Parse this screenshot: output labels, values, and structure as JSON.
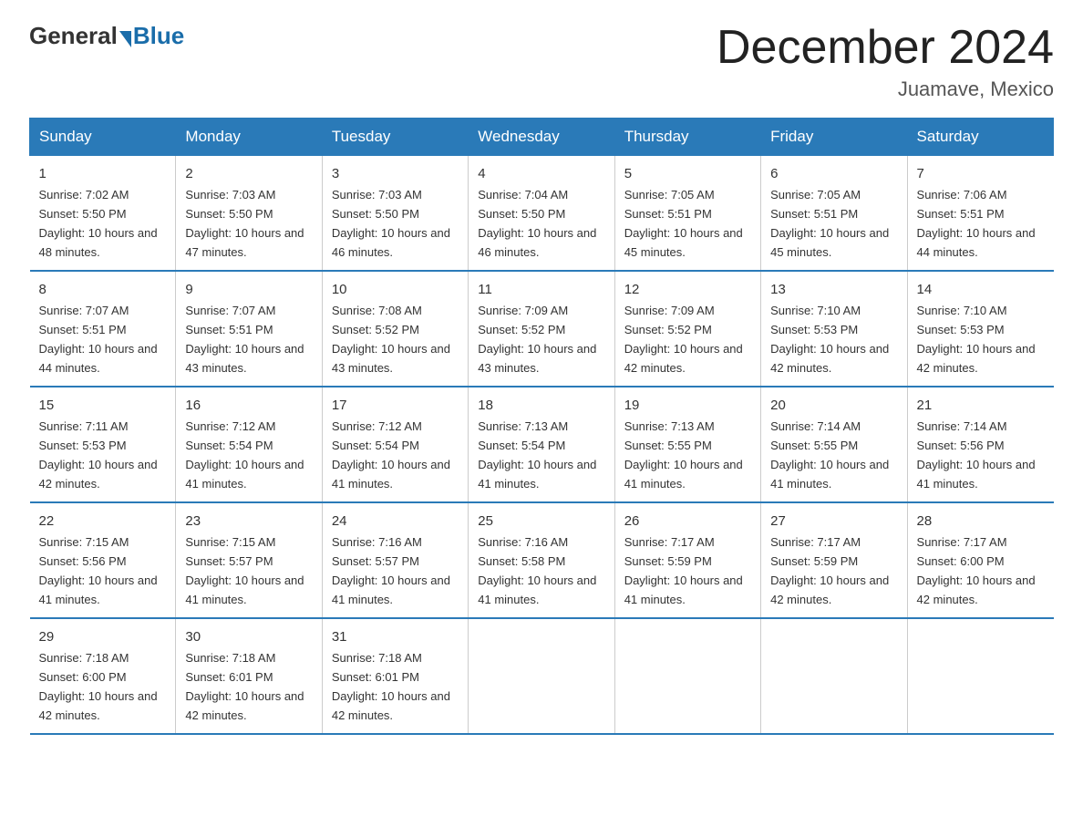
{
  "logo": {
    "general": "General",
    "blue": "Blue"
  },
  "title": "December 2024",
  "location": "Juamave, Mexico",
  "weekdays": [
    "Sunday",
    "Monday",
    "Tuesday",
    "Wednesday",
    "Thursday",
    "Friday",
    "Saturday"
  ],
  "weeks": [
    [
      {
        "day": "1",
        "sunrise": "7:02 AM",
        "sunset": "5:50 PM",
        "daylight": "10 hours and 48 minutes."
      },
      {
        "day": "2",
        "sunrise": "7:03 AM",
        "sunset": "5:50 PM",
        "daylight": "10 hours and 47 minutes."
      },
      {
        "day": "3",
        "sunrise": "7:03 AM",
        "sunset": "5:50 PM",
        "daylight": "10 hours and 46 minutes."
      },
      {
        "day": "4",
        "sunrise": "7:04 AM",
        "sunset": "5:50 PM",
        "daylight": "10 hours and 46 minutes."
      },
      {
        "day": "5",
        "sunrise": "7:05 AM",
        "sunset": "5:51 PM",
        "daylight": "10 hours and 45 minutes."
      },
      {
        "day": "6",
        "sunrise": "7:05 AM",
        "sunset": "5:51 PM",
        "daylight": "10 hours and 45 minutes."
      },
      {
        "day": "7",
        "sunrise": "7:06 AM",
        "sunset": "5:51 PM",
        "daylight": "10 hours and 44 minutes."
      }
    ],
    [
      {
        "day": "8",
        "sunrise": "7:07 AM",
        "sunset": "5:51 PM",
        "daylight": "10 hours and 44 minutes."
      },
      {
        "day": "9",
        "sunrise": "7:07 AM",
        "sunset": "5:51 PM",
        "daylight": "10 hours and 43 minutes."
      },
      {
        "day": "10",
        "sunrise": "7:08 AM",
        "sunset": "5:52 PM",
        "daylight": "10 hours and 43 minutes."
      },
      {
        "day": "11",
        "sunrise": "7:09 AM",
        "sunset": "5:52 PM",
        "daylight": "10 hours and 43 minutes."
      },
      {
        "day": "12",
        "sunrise": "7:09 AM",
        "sunset": "5:52 PM",
        "daylight": "10 hours and 42 minutes."
      },
      {
        "day": "13",
        "sunrise": "7:10 AM",
        "sunset": "5:53 PM",
        "daylight": "10 hours and 42 minutes."
      },
      {
        "day": "14",
        "sunrise": "7:10 AM",
        "sunset": "5:53 PM",
        "daylight": "10 hours and 42 minutes."
      }
    ],
    [
      {
        "day": "15",
        "sunrise": "7:11 AM",
        "sunset": "5:53 PM",
        "daylight": "10 hours and 42 minutes."
      },
      {
        "day": "16",
        "sunrise": "7:12 AM",
        "sunset": "5:54 PM",
        "daylight": "10 hours and 41 minutes."
      },
      {
        "day": "17",
        "sunrise": "7:12 AM",
        "sunset": "5:54 PM",
        "daylight": "10 hours and 41 minutes."
      },
      {
        "day": "18",
        "sunrise": "7:13 AM",
        "sunset": "5:54 PM",
        "daylight": "10 hours and 41 minutes."
      },
      {
        "day": "19",
        "sunrise": "7:13 AM",
        "sunset": "5:55 PM",
        "daylight": "10 hours and 41 minutes."
      },
      {
        "day": "20",
        "sunrise": "7:14 AM",
        "sunset": "5:55 PM",
        "daylight": "10 hours and 41 minutes."
      },
      {
        "day": "21",
        "sunrise": "7:14 AM",
        "sunset": "5:56 PM",
        "daylight": "10 hours and 41 minutes."
      }
    ],
    [
      {
        "day": "22",
        "sunrise": "7:15 AM",
        "sunset": "5:56 PM",
        "daylight": "10 hours and 41 minutes."
      },
      {
        "day": "23",
        "sunrise": "7:15 AM",
        "sunset": "5:57 PM",
        "daylight": "10 hours and 41 minutes."
      },
      {
        "day": "24",
        "sunrise": "7:16 AM",
        "sunset": "5:57 PM",
        "daylight": "10 hours and 41 minutes."
      },
      {
        "day": "25",
        "sunrise": "7:16 AM",
        "sunset": "5:58 PM",
        "daylight": "10 hours and 41 minutes."
      },
      {
        "day": "26",
        "sunrise": "7:17 AM",
        "sunset": "5:59 PM",
        "daylight": "10 hours and 41 minutes."
      },
      {
        "day": "27",
        "sunrise": "7:17 AM",
        "sunset": "5:59 PM",
        "daylight": "10 hours and 42 minutes."
      },
      {
        "day": "28",
        "sunrise": "7:17 AM",
        "sunset": "6:00 PM",
        "daylight": "10 hours and 42 minutes."
      }
    ],
    [
      {
        "day": "29",
        "sunrise": "7:18 AM",
        "sunset": "6:00 PM",
        "daylight": "10 hours and 42 minutes."
      },
      {
        "day": "30",
        "sunrise": "7:18 AM",
        "sunset": "6:01 PM",
        "daylight": "10 hours and 42 minutes."
      },
      {
        "day": "31",
        "sunrise": "7:18 AM",
        "sunset": "6:01 PM",
        "daylight": "10 hours and 42 minutes."
      },
      null,
      null,
      null,
      null
    ]
  ]
}
